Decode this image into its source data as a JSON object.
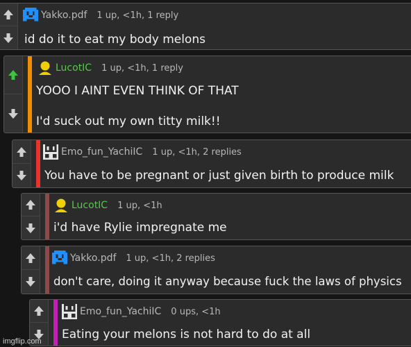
{
  "comments": [
    {
      "user": "Yakko.pdf",
      "meta": "1 up, <1h, 1 reply",
      "lines": [
        "id do it to eat my body melons"
      ],
      "avatar": "blue-pixel-avatar-icon",
      "bar_color": null,
      "upvoted": false
    },
    {
      "user": "LucotIC",
      "meta": "1 up, <1h, 1 reply",
      "lines": [
        "YOOO I AINT EVEN THINK OF THAT",
        "I'd suck out my own titty milk!!"
      ],
      "avatar": "yellow-person-avatar-icon",
      "bar_color": "#f28c00",
      "upvoted": true
    },
    {
      "user": "Emo_fun_YachiIC",
      "meta": "1 up, <1h, 2 replies",
      "lines": [
        "You have to be pregnant or just given birth to produce milk"
      ],
      "avatar": "white-pixel-avatar-icon",
      "bar_color": "#e8342a",
      "upvoted": false
    },
    {
      "user": "LucotIC",
      "meta": "1 up, <1h",
      "lines": [
        "i'd have Rylie impregnate me"
      ],
      "avatar": "yellow-person-avatar-icon",
      "bar_color": "#8a4a4a",
      "upvoted": false
    },
    {
      "user": "Yakko.pdf",
      "meta": "1 up, <1h, 2 replies",
      "lines": [
        "don't care, doing it anyway because fuck the laws of physics"
      ],
      "avatar": "blue-pixel-avatar-icon",
      "bar_color": "#8a4a4a",
      "upvoted": false
    },
    {
      "user": "Emo_fun_YachiIC",
      "meta": "0 ups, <1h",
      "lines": [
        "Eating your melons is not hard to do at all"
      ],
      "avatar": "white-pixel-avatar-icon",
      "bar_color": "#c21fb4",
      "upvoted": false
    }
  ],
  "watermark": "imgflip.com"
}
